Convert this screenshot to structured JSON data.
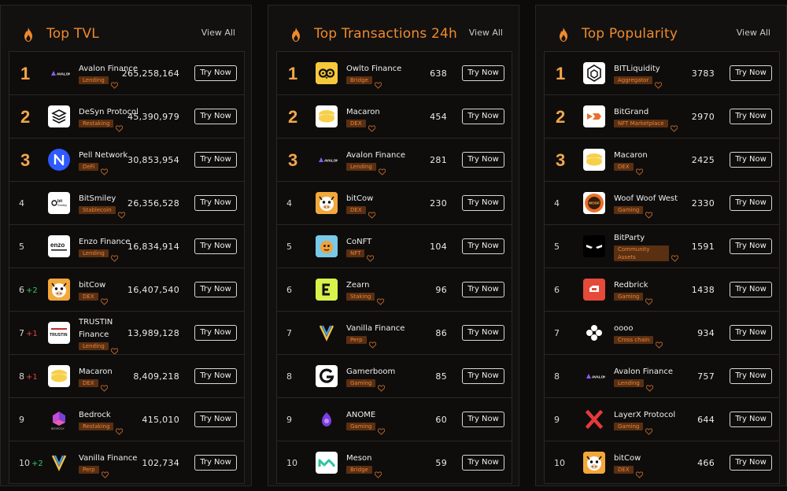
{
  "colors": {
    "accent": "#f08a2c",
    "tag_bg": "#5a2f12",
    "tag_text": "#e8853a",
    "up": "#36c46a",
    "down": "#e04545"
  },
  "panels": [
    {
      "title": "Top TVL",
      "view_all": "View All",
      "button_label": "Try Now",
      "rows": [
        {
          "rank": "1",
          "name": "Avalon Finance",
          "tag": "Lending",
          "value": "265,258,164",
          "icon": "avalon-logo-icon"
        },
        {
          "rank": "2",
          "name": "DeSyn Protocol",
          "tag": "Restaking",
          "value": "45,390,979",
          "icon": "desyn-logo-icon"
        },
        {
          "rank": "3",
          "name": "Pell Network",
          "tag": "DeFi",
          "value": "30,853,954",
          "icon": "pell-logo-icon"
        },
        {
          "rank": "4",
          "name": "BitSmiley",
          "tag": "Stablecoin",
          "value": "26,356,528",
          "icon": "bitsmiley-logo-icon"
        },
        {
          "rank": "5",
          "name": "Enzo Finance",
          "tag": "Lending",
          "value": "16,834,914",
          "icon": "enzo-logo-icon"
        },
        {
          "rank": "6",
          "delta": "+2",
          "dir": "up",
          "name": "bitCow",
          "tag": "DEX",
          "value": "16,407,540",
          "icon": "bitcow-logo-icon"
        },
        {
          "rank": "7",
          "delta": "+1",
          "dir": "down",
          "name": "TRUSTIN Finance",
          "tag": "Lending",
          "value": "13,989,128",
          "icon": "trustin-logo-icon"
        },
        {
          "rank": "8",
          "delta": "+1",
          "dir": "down",
          "name": "Macaron",
          "tag": "DEX",
          "value": "8,409,218",
          "icon": "macaron-logo-icon"
        },
        {
          "rank": "9",
          "name": "Bedrock",
          "tag": "Restaking",
          "value": "415,010",
          "icon": "bedrock-logo-icon"
        },
        {
          "rank": "10",
          "delta": "+2",
          "dir": "up",
          "name": "Vanilla Finance",
          "tag": "Perp",
          "value": "102,734",
          "icon": "vanilla-logo-icon"
        }
      ]
    },
    {
      "title": "Top Transactions 24h",
      "view_all": "View All",
      "button_label": "Try Now",
      "rows": [
        {
          "rank": "1",
          "name": "Owlto Finance",
          "tag": "Bridge",
          "value": "638",
          "icon": "owlto-logo-icon"
        },
        {
          "rank": "2",
          "name": "Macaron",
          "tag": "DEX",
          "value": "454",
          "icon": "macaron-logo-icon"
        },
        {
          "rank": "3",
          "name": "Avalon Finance",
          "tag": "Lending",
          "value": "281",
          "icon": "avalon-logo-icon"
        },
        {
          "rank": "4",
          "name": "bitCow",
          "tag": "DEX",
          "value": "230",
          "icon": "bitcow-logo-icon"
        },
        {
          "rank": "5",
          "name": "CoNFT",
          "tag": "NFT",
          "value": "104",
          "icon": "conft-logo-icon"
        },
        {
          "rank": "6",
          "name": "Zearn",
          "tag": "Staking",
          "value": "96",
          "icon": "zearn-logo-icon"
        },
        {
          "rank": "7",
          "name": "Vanilla Finance",
          "tag": "Perp",
          "value": "86",
          "icon": "vanilla-logo-icon"
        },
        {
          "rank": "8",
          "name": "Gamerboom",
          "tag": "Gaming",
          "value": "85",
          "icon": "gamerboom-logo-icon"
        },
        {
          "rank": "9",
          "name": "ANOME",
          "tag": "Gaming",
          "value": "60",
          "icon": "anome-logo-icon"
        },
        {
          "rank": "10",
          "name": "Meson",
          "tag": "Bridge",
          "value": "59",
          "icon": "meson-logo-icon"
        }
      ]
    },
    {
      "title": "Top Popularity",
      "view_all": "View All",
      "button_label": "Try Now",
      "rows": [
        {
          "rank": "1",
          "name": "BITLiquidity",
          "tag": "Aggregator",
          "value": "3783",
          "icon": "bitliquidity-logo-icon"
        },
        {
          "rank": "2",
          "name": "BitGrand",
          "tag": "NFT Marketplace",
          "value": "2970",
          "icon": "bitgrand-logo-icon"
        },
        {
          "rank": "3",
          "name": "Macaron",
          "tag": "DEX",
          "value": "2425",
          "icon": "macaron-logo-icon"
        },
        {
          "rank": "4",
          "name": "Woof Woof West",
          "tag": "Gaming",
          "value": "2330",
          "icon": "woofwoof-logo-icon"
        },
        {
          "rank": "5",
          "name": "BitParty",
          "tag": "Community Assets",
          "value": "1591",
          "icon": "bitparty-logo-icon"
        },
        {
          "rank": "6",
          "name": "Redbrick",
          "tag": "Gaming",
          "value": "1438",
          "icon": "redbrick-logo-icon"
        },
        {
          "rank": "7",
          "name": "oooo",
          "tag": "Cross chain",
          "value": "934",
          "icon": "oooo-logo-icon"
        },
        {
          "rank": "8",
          "name": "Avalon Finance",
          "tag": "Lending",
          "value": "757",
          "icon": "avalon-logo-icon"
        },
        {
          "rank": "9",
          "name": "LayerX Protocol",
          "tag": "Gaming",
          "value": "644",
          "icon": "layerx-logo-icon"
        },
        {
          "rank": "10",
          "name": "bitCow",
          "tag": "DEX",
          "value": "466",
          "icon": "bitcow-logo-icon"
        }
      ]
    }
  ]
}
